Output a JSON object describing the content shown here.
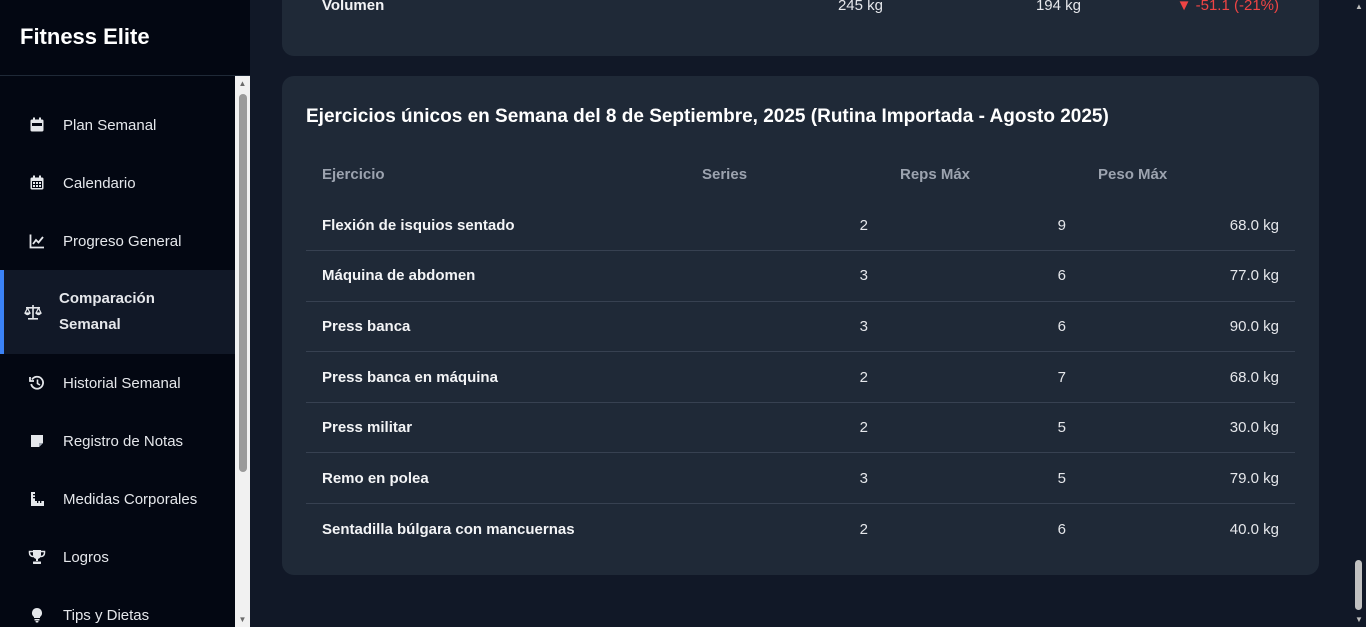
{
  "app": {
    "title": "Fitness Elite"
  },
  "sidebar": {
    "items": [
      {
        "label": "Plan Semanal",
        "icon": "calendar-week-icon"
      },
      {
        "label": "Calendario",
        "icon": "calendar-icon"
      },
      {
        "label": "Progreso General",
        "icon": "chart-line-icon"
      },
      {
        "label": "Comparación Semanal",
        "icon": "balance-scale-icon",
        "active": true
      },
      {
        "label": "Historial Semanal",
        "icon": "history-icon"
      },
      {
        "label": "Registro de Notas",
        "icon": "sticky-note-icon"
      },
      {
        "label": "Medidas Corporales",
        "icon": "ruler-icon"
      },
      {
        "label": "Logros",
        "icon": "trophy-icon"
      },
      {
        "label": "Tips y Dietas",
        "icon": "lightbulb-icon"
      }
    ],
    "accent_color": "#3b82f6"
  },
  "volume_row": {
    "label": "Volumen",
    "value_a": "245 kg",
    "value_b": "194 kg",
    "diff": "▼ -51.1 (-21%)",
    "diff_color": "#ef4444"
  },
  "unique_exercises": {
    "title": "Ejercicios únicos en Semana del 8 de Septiembre, 2025 (Rutina Importada - Agosto 2025)",
    "columns": [
      "Ejercicio",
      "Series",
      "Reps Máx",
      "Peso Máx"
    ],
    "rows": [
      {
        "name": "Flexión de isquios sentado",
        "series": "2",
        "reps": "9",
        "weight": "68.0 kg"
      },
      {
        "name": "Máquina de abdomen",
        "series": "3",
        "reps": "6",
        "weight": "77.0 kg"
      },
      {
        "name": "Press banca",
        "series": "3",
        "reps": "6",
        "weight": "90.0 kg"
      },
      {
        "name": "Press banca en máquina",
        "series": "2",
        "reps": "7",
        "weight": "68.0 kg"
      },
      {
        "name": "Press militar",
        "series": "2",
        "reps": "5",
        "weight": "30.0 kg"
      },
      {
        "name": "Remo en polea",
        "series": "3",
        "reps": "5",
        "weight": "79.0 kg"
      },
      {
        "name": "Sentadilla búlgara con mancuernas",
        "series": "2",
        "reps": "6",
        "weight": "40.0 kg"
      }
    ]
  }
}
